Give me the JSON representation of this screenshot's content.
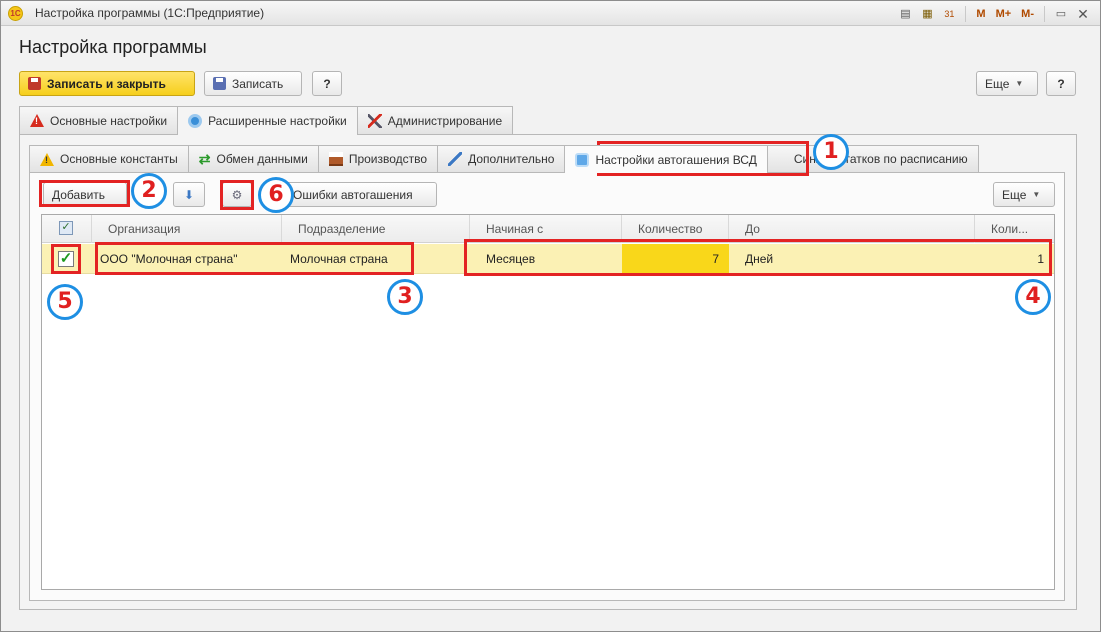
{
  "window": {
    "title": "Настройка программы  (1С:Предприятие)",
    "logo_text": "1С",
    "toolbar_icons": [
      "document-icon",
      "calculator-icon",
      "calendar-icon"
    ],
    "calendar_day": "31",
    "memory_buttons": [
      "M",
      "M+",
      "M-"
    ]
  },
  "form": {
    "title": "Настройка программы",
    "buttons": {
      "save_close": "Записать и закрыть",
      "save": "Записать",
      "help": "?",
      "more": "Еще",
      "help_right": "?"
    }
  },
  "tabs_top": [
    {
      "label": "Основные настройки",
      "icon": "warning-icon"
    },
    {
      "label": "Расширенные настройки",
      "icon": "gear-icon",
      "active": true
    },
    {
      "label": "Администрирование",
      "icon": "tools-icon"
    }
  ],
  "tabs_inner": [
    {
      "label": "Основные константы",
      "icon": "warning-icon"
    },
    {
      "label": "Обмен данными",
      "icon": "exchange-icon"
    },
    {
      "label": "Производство",
      "icon": "factory-icon"
    },
    {
      "label": "Дополнительно",
      "icon": "wrench-icon"
    },
    {
      "label": "Настройки автогашения ВСД",
      "icon": "auto-icon",
      "active": true
    },
    {
      "label": "Синхр остатков по расписанию",
      "icon": ""
    }
  ],
  "table_toolbar": {
    "add": "Добавить",
    "errors": "Ошибки автогашения",
    "more": "Еще"
  },
  "table": {
    "columns": [
      "Организация",
      "Подразделение",
      "Начиная с",
      "Количество",
      "До",
      "Коли..."
    ],
    "rows": [
      {
        "checked": true,
        "org": "ООО \"Молочная страна\"",
        "division": "Молочная страна",
        "starting": "Месяцев",
        "quantity": "7",
        "to": "Дней",
        "quantity2": "1"
      }
    ]
  },
  "callouts": [
    "1",
    "2",
    "3",
    "4",
    "5",
    "6"
  ]
}
